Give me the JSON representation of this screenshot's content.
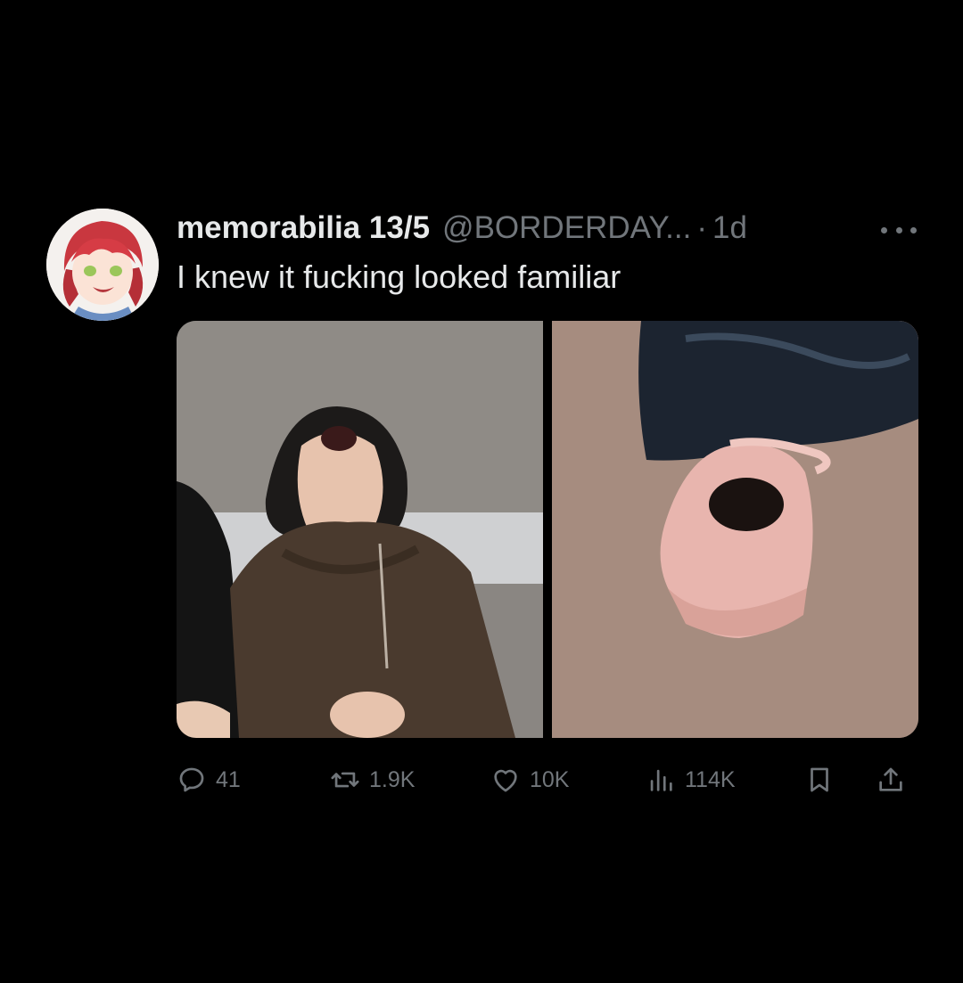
{
  "tweet": {
    "display_name": "memorabilia 13/5",
    "handle": "@BORDERDAY...",
    "separator": "·",
    "time": "1d",
    "text": "I knew it fucking looked familiar"
  },
  "metrics": {
    "replies": "41",
    "reposts": "1.9K",
    "likes": "10K",
    "views": "114K"
  },
  "icons": {
    "more": "more-horizontal-icon",
    "reply": "reply-icon",
    "repost": "repost-icon",
    "like": "heart-icon",
    "views": "views-chart-icon",
    "bookmark": "bookmark-icon",
    "share": "share-icon"
  },
  "colors": {
    "background": "#000000",
    "primary_text": "#e7e9ea",
    "secondary_text": "#71767b"
  }
}
